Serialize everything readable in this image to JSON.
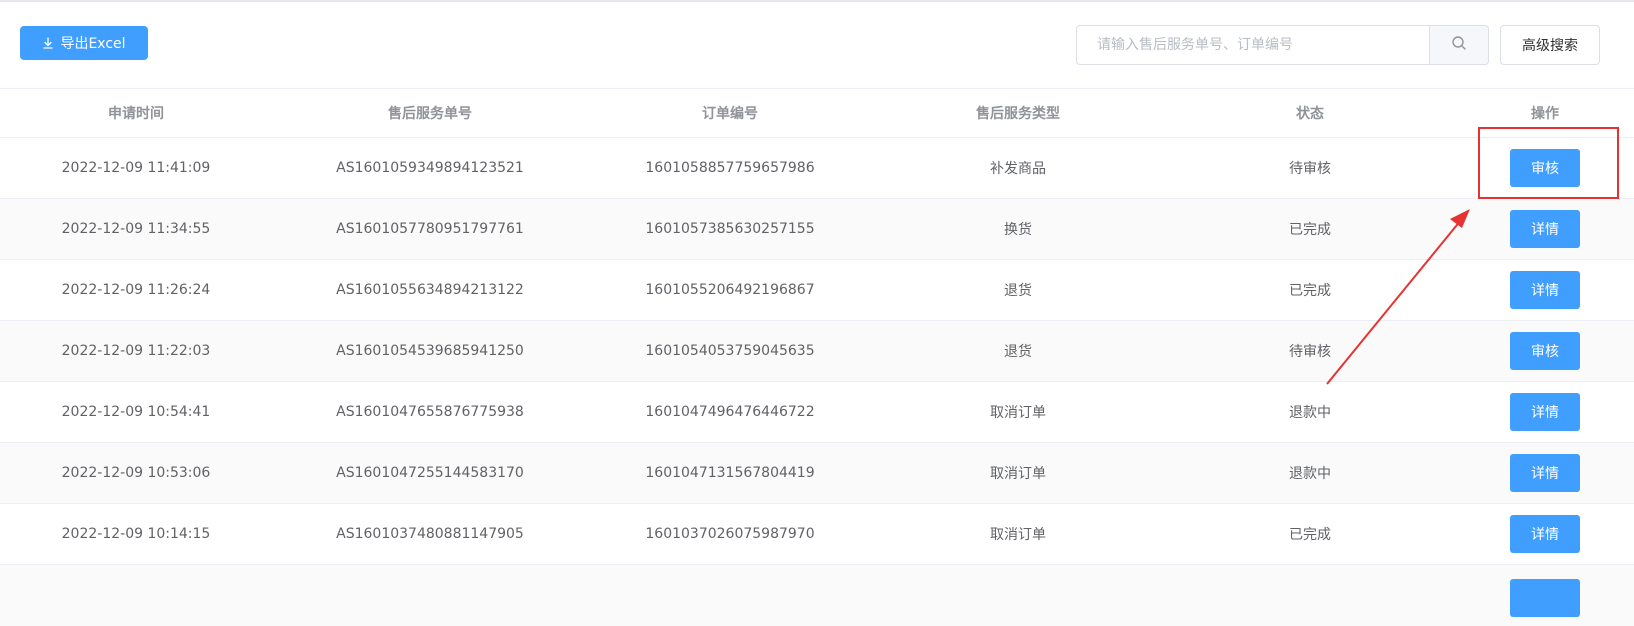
{
  "toolbar": {
    "export_label": "导出Excel",
    "search_placeholder": "请输入售后服务单号、订单编号",
    "search_value": "",
    "advanced_search_label": "高级搜索"
  },
  "table": {
    "headers": [
      "申请时间",
      "售后服务单号",
      "订单编号",
      "售后服务类型",
      "状态",
      "操作"
    ],
    "rows": [
      {
        "time": "2022-12-09 11:41:09",
        "service_no": "AS1601059349894123521",
        "order_no": "1601058857759657986",
        "type": "补发商品",
        "status": "待审核",
        "action": "审核"
      },
      {
        "time": "2022-12-09 11:34:55",
        "service_no": "AS1601057780951797761",
        "order_no": "1601057385630257155",
        "type": "换货",
        "status": "已完成",
        "action": "详情"
      },
      {
        "time": "2022-12-09 11:26:24",
        "service_no": "AS1601055634894213122",
        "order_no": "1601055206492196867",
        "type": "退货",
        "status": "已完成",
        "action": "详情"
      },
      {
        "time": "2022-12-09 11:22:03",
        "service_no": "AS1601054539685941250",
        "order_no": "1601054053759045635",
        "type": "退货",
        "status": "待审核",
        "action": "审核"
      },
      {
        "time": "2022-12-09 10:54:41",
        "service_no": "AS1601047655876775938",
        "order_no": "1601047496476446722",
        "type": "取消订单",
        "status": "退款中",
        "action": "详情"
      },
      {
        "time": "2022-12-09 10:53:06",
        "service_no": "AS1601047255144583170",
        "order_no": "1601047131567804419",
        "type": "取消订单",
        "status": "退款中",
        "action": "详情"
      },
      {
        "time": "2022-12-09 10:14:15",
        "service_no": "AS1601037480881147905",
        "order_no": "1601037026075987970",
        "type": "取消订单",
        "status": "已完成",
        "action": "详情"
      }
    ]
  },
  "colors": {
    "primary": "#409eff",
    "annotation": "#e63232",
    "header_text": "#909399",
    "cell_text": "#606266",
    "stripe": "#fafafa"
  },
  "icons": {
    "export": "download-icon",
    "search": "search-icon",
    "annotation_arrow": "annotation-arrow"
  }
}
